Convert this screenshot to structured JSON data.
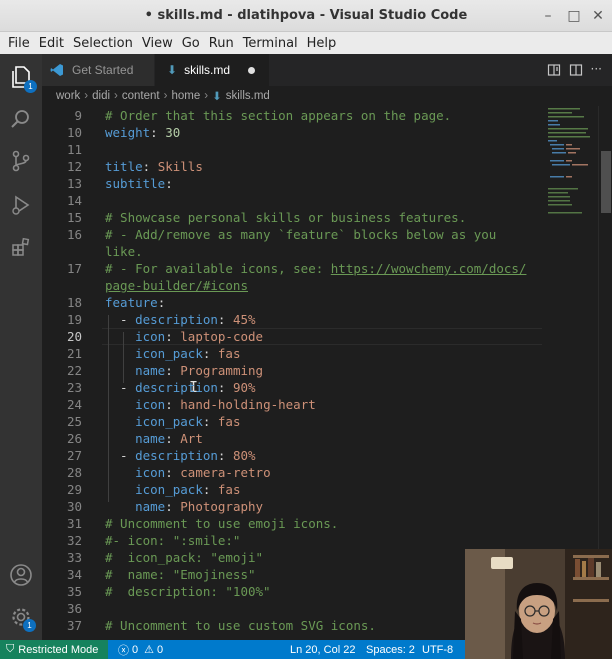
{
  "window": {
    "title": "• skills.md - dlatihpova - Visual Studio Code"
  },
  "menu": [
    "File",
    "Edit",
    "Selection",
    "View",
    "Go",
    "Run",
    "Terminal",
    "Help"
  ],
  "activity_bar": {
    "explorer_badge": "1",
    "settings_badge": "1"
  },
  "tabs": [
    {
      "label": "Get Started",
      "icon": "vscode-logo-icon",
      "active": false
    },
    {
      "label": "skills.md",
      "icon": "markdown-arrow-icon",
      "active": true,
      "modified": true
    }
  ],
  "breadcrumb": [
    "work",
    "didi",
    "content",
    "home",
    "skills.md"
  ],
  "editor": {
    "current_line": 20,
    "lines": [
      {
        "n": "9",
        "text": "# Order that this section appears on the page."
      },
      {
        "n": "10",
        "text": "weight: 30"
      },
      {
        "n": "11",
        "text": ""
      },
      {
        "n": "12",
        "text": "title: Skills"
      },
      {
        "n": "13",
        "text": "subtitle:"
      },
      {
        "n": "14",
        "text": ""
      },
      {
        "n": "15",
        "text": "# Showcase personal skills or business features."
      },
      {
        "n": "16",
        "text": "# - Add/remove as many `feature` blocks below as you"
      },
      {
        "n": "",
        "text": "like."
      },
      {
        "n": "17",
        "text": "# - For available icons, see: https://wowchemy.com/docs/"
      },
      {
        "n": "",
        "text": "page-builder/#icons"
      },
      {
        "n": "18",
        "text": "feature:"
      },
      {
        "n": "19",
        "text": "  - description: 45%"
      },
      {
        "n": "20",
        "text": "    icon: laptop-code"
      },
      {
        "n": "21",
        "text": "    icon_pack: fas"
      },
      {
        "n": "22",
        "text": "    name: Programming"
      },
      {
        "n": "23",
        "text": "  - description: 90%"
      },
      {
        "n": "24",
        "text": "    icon: hand-holding-heart"
      },
      {
        "n": "25",
        "text": "    icon_pack: fas"
      },
      {
        "n": "26",
        "text": "    name: Art"
      },
      {
        "n": "27",
        "text": "  - description: 80%"
      },
      {
        "n": "28",
        "text": "    icon: camera-retro"
      },
      {
        "n": "29",
        "text": "    icon_pack: fas"
      },
      {
        "n": "30",
        "text": "    name: Photography"
      },
      {
        "n": "31",
        "text": "# Uncomment to use emoji icons."
      },
      {
        "n": "32",
        "text": "#- icon: \":smile:\""
      },
      {
        "n": "33",
        "text": "#  icon_pack: \"emoji\""
      },
      {
        "n": "34",
        "text": "#  name: \"Emojiness\""
      },
      {
        "n": "35",
        "text": "#  description: \"100%\""
      },
      {
        "n": "36",
        "text": ""
      },
      {
        "n": "37",
        "text": "# Uncomment to use custom SVG icons."
      }
    ]
  },
  "status": {
    "restricted": "Restricted Mode",
    "problems_errors": "0",
    "problems_warnings": "0",
    "position": "Ln 20, Col 22",
    "spaces": "Spaces: 2",
    "encoding": "UTF-8"
  },
  "colors": {
    "comment": "#6a9955",
    "key": "#569cd6",
    "string": "#ce9178",
    "number": "#b5cea8",
    "status_bar": "#007acc",
    "restricted_mode": "#16825d"
  }
}
